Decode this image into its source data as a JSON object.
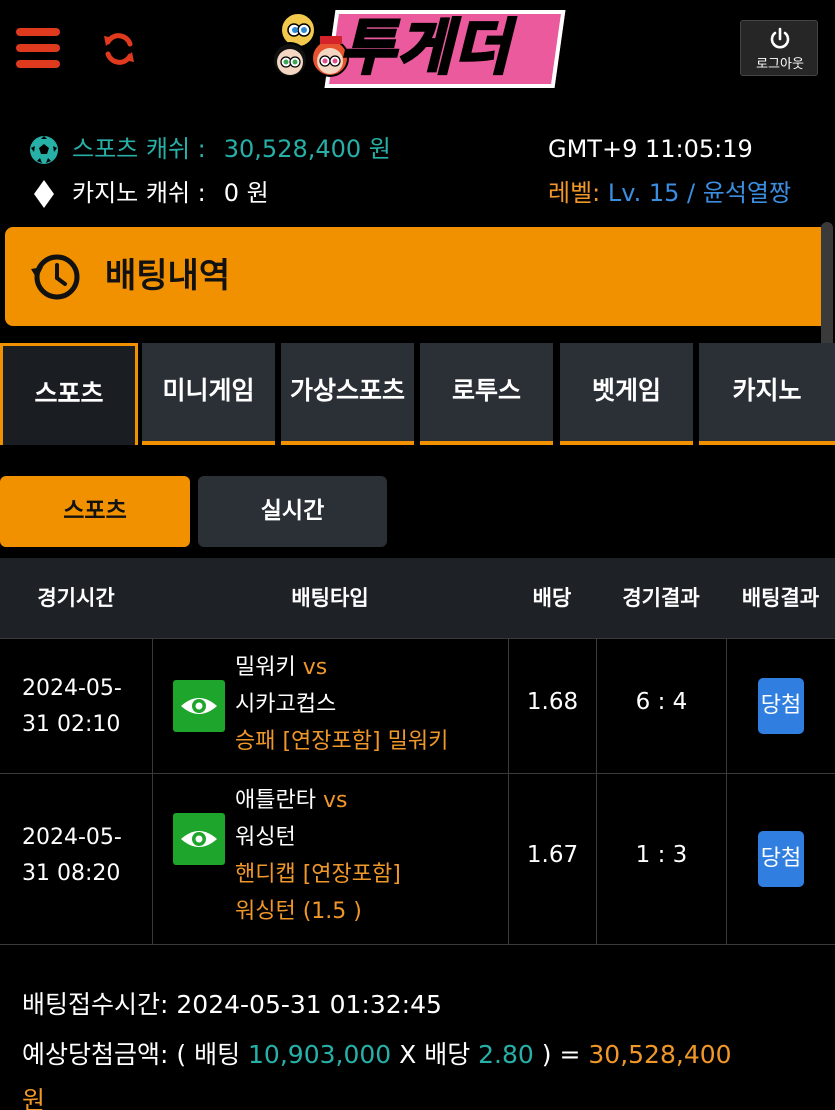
{
  "header": {
    "logo_text": "투게더",
    "logout_label": "로그아웃"
  },
  "info": {
    "sports_cash_label": "스포츠 캐쉬 :",
    "sports_cash_value": "30,528,400 원",
    "casino_cash_label": "카지노 캐쉬 :",
    "casino_cash_value": "0 원",
    "clock": "GMT+9 11:05:19",
    "level_label": "레벨:",
    "level_value": "Lv. 15 / 윤석열짱"
  },
  "page_title": "배팅내역",
  "category_tabs": [
    {
      "label": "스포츠",
      "active": true
    },
    {
      "label": "미니게임",
      "active": false
    },
    {
      "label": "가상스포츠",
      "active": false
    },
    {
      "label": "로투스",
      "active": false
    },
    {
      "label": "벳게임",
      "active": false
    },
    {
      "label": "카지노",
      "active": false
    }
  ],
  "sub_tabs": [
    {
      "label": "스포츠",
      "active": true
    },
    {
      "label": "실시간",
      "active": false
    }
  ],
  "table": {
    "headers": [
      "경기시간",
      "배팅타입",
      "배당",
      "경기결과",
      "배팅결과"
    ],
    "rows": [
      {
        "date_line1": "2024-05-",
        "date_line2": "31 02:10",
        "home": "밀워키",
        "vs": "vs",
        "away": "시카고컵스",
        "bet_line1": "승패 [연장포함] 밀워키",
        "bet_line2": "",
        "odds": "1.68",
        "score": "6 : 4",
        "result": "당첨"
      },
      {
        "date_line1": "2024-05-",
        "date_line2": "31 08:20",
        "home": "애틀란타",
        "vs": "vs",
        "away": "워싱턴",
        "bet_line1": "핸디캡 [연장포함]",
        "bet_line2": "워싱턴 (1.5 )",
        "odds": "1.67",
        "score": "1 : 3",
        "result": "당첨"
      }
    ]
  },
  "footer": {
    "accept_time_label": "배팅접수시간:",
    "accept_time_value": "2024-05-31 01:32:45",
    "expected_label": "예상당첨금액: ( 배팅",
    "bet_amount": "10,903,000",
    "x_label": "X 배당",
    "total_odds": "2.80",
    "eq_label": ") =",
    "expected_value": "30,528,400",
    "unit": "원"
  },
  "colors": {
    "accent": "#f29100",
    "teal": "#27b0a8",
    "orange_text": "#f0972a",
    "blue": "#2f7ee0",
    "green_button": "#1ea52b"
  }
}
